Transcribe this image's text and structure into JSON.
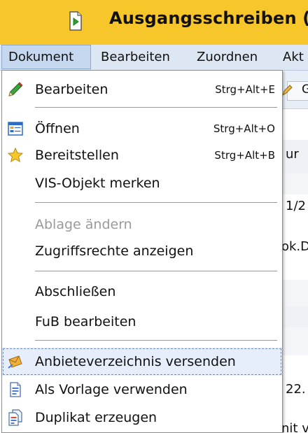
{
  "window": {
    "title": "Ausgangsschreiben (",
    "icon": "document-arrow-icon"
  },
  "menubar": {
    "items": [
      {
        "label": "Dokument",
        "active": true
      },
      {
        "label": "Bearbeiten",
        "active": false
      },
      {
        "label": "Zuordnen",
        "active": false
      },
      {
        "label": "Akt",
        "active": false
      }
    ]
  },
  "background": {
    "toolbar_button": "G",
    "column_header": "ur",
    "row_fragments": [
      "1/2",
      "ok.D",
      "22.",
      "nit v"
    ]
  },
  "dropdown": {
    "items": [
      {
        "label": "Bearbeiten",
        "shortcut": "Strg+Alt+E",
        "icon": "pencil-icon",
        "disabled": false
      },
      {
        "label": "Öffnen",
        "shortcut": "Strg+Alt+O",
        "icon": "open-form-icon",
        "disabled": false
      },
      {
        "label": "Bereitstellen",
        "shortcut": "Strg+Alt+B",
        "icon": "star-icon",
        "disabled": false
      },
      {
        "label": "VIS-Objekt merken",
        "shortcut": "",
        "icon": "",
        "disabled": false
      },
      {
        "label": "Ablage ändern",
        "shortcut": "",
        "icon": "",
        "disabled": true
      },
      {
        "label": "Zugriffsrechte anzeigen",
        "shortcut": "",
        "icon": "",
        "disabled": false
      },
      {
        "label": "Abschließen",
        "shortcut": "",
        "icon": "",
        "disabled": false
      },
      {
        "label": "FuB bearbeiten",
        "shortcut": "",
        "icon": "",
        "disabled": false
      },
      {
        "label": "Anbieteverzeichnis versenden",
        "shortcut": "",
        "icon": "send-envelope-icon",
        "disabled": false,
        "highlighted": true
      },
      {
        "label": "Als Vorlage verwenden",
        "shortcut": "",
        "icon": "template-document-icon",
        "disabled": false
      },
      {
        "label": "Duplikat erzeugen",
        "shortcut": "",
        "icon": "duplicate-document-icon",
        "disabled": false
      }
    ]
  },
  "colors": {
    "titlebar": "#f6c62b",
    "menubar": "#dde7f4",
    "highlight": "#e6eefb",
    "disabled_text": "#9a9a9a"
  }
}
